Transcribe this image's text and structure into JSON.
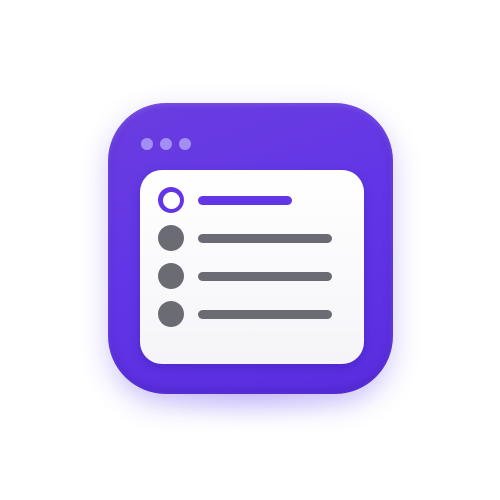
{
  "colors": {
    "accent": "#6236e6",
    "muted": "#6b6b73",
    "dots": "#a38ff3",
    "card": "#ffffff"
  },
  "icon": {
    "name": "checklist-app-icon",
    "window_dots": 3,
    "rows": [
      {
        "state": "selected"
      },
      {
        "state": "unselected"
      },
      {
        "state": "unselected"
      },
      {
        "state": "unselected"
      }
    ]
  }
}
